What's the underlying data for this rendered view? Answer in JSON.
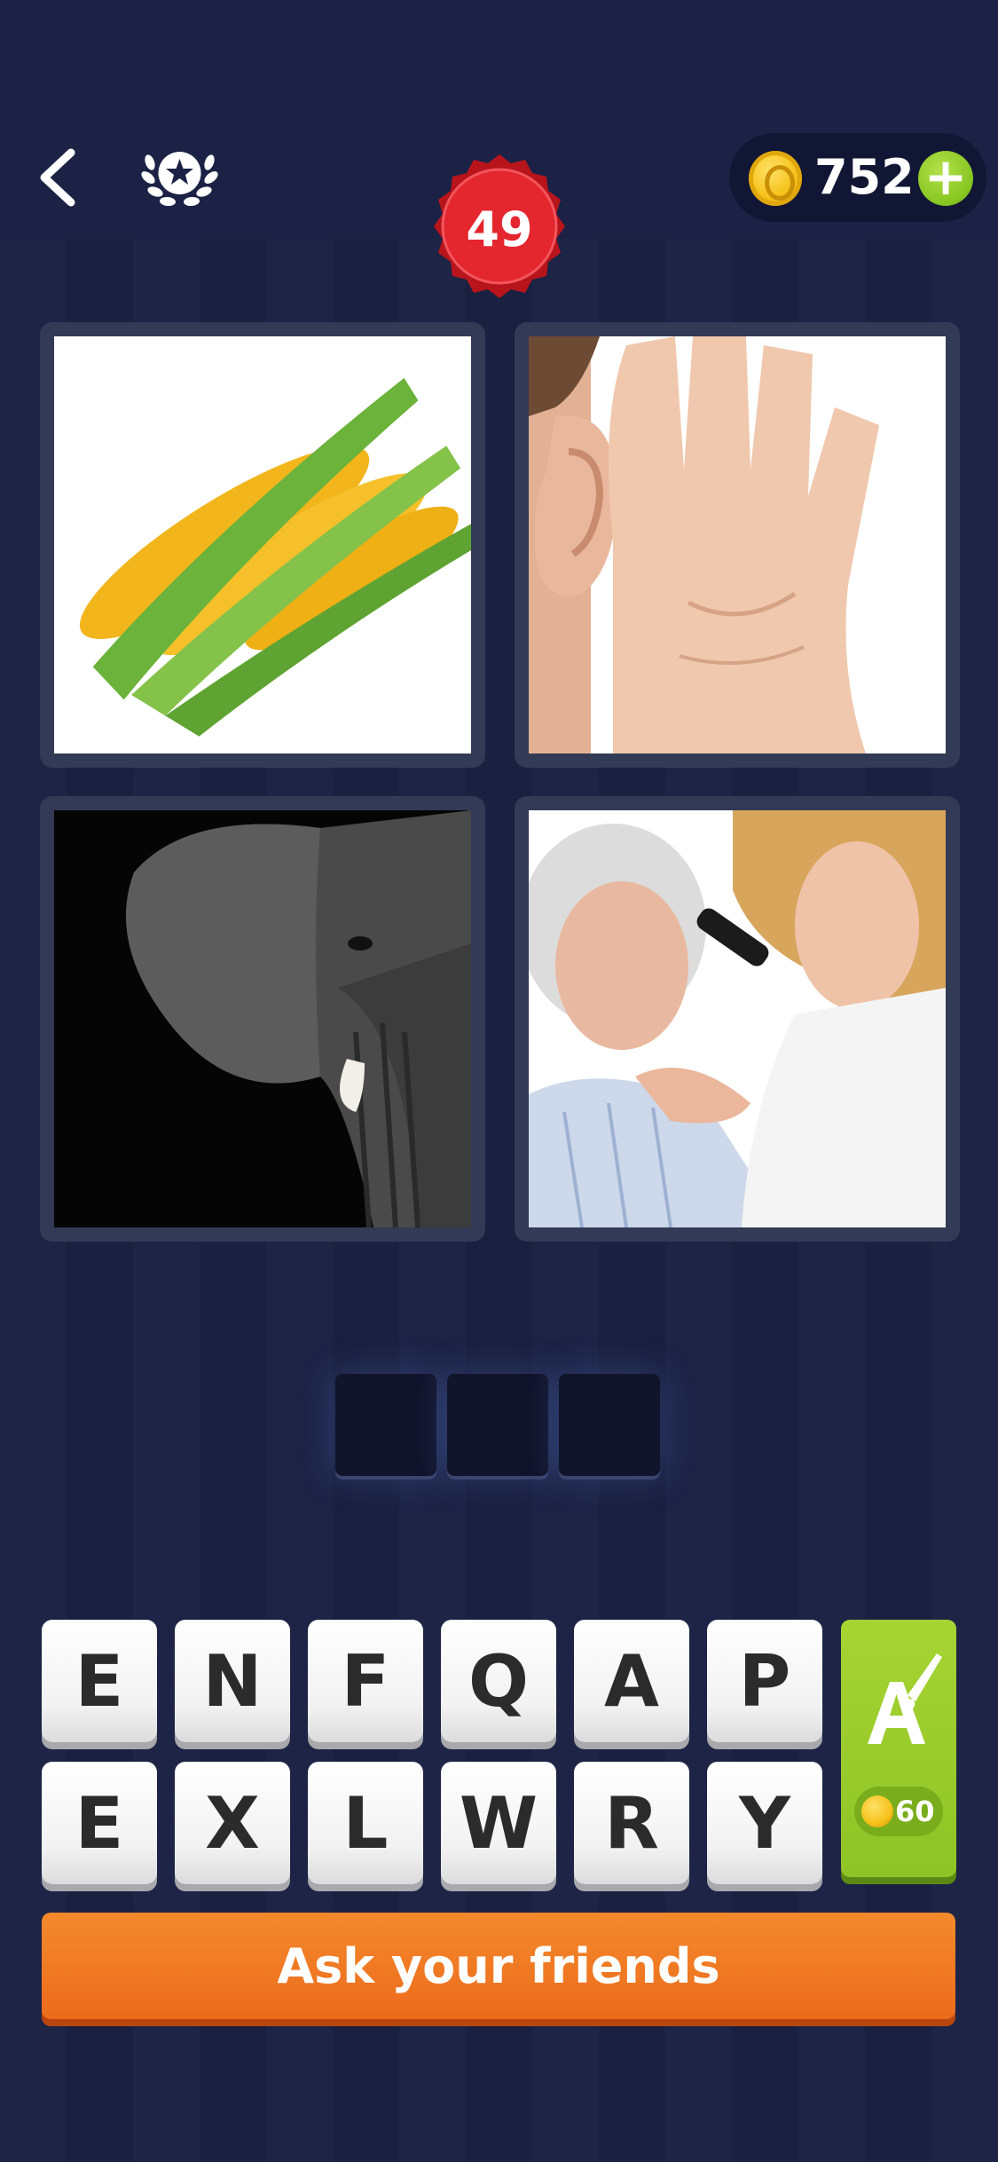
{
  "header": {
    "level": "49",
    "coins": "752",
    "add_coins_label": "+"
  },
  "pictures": [
    {
      "name": "corn-picture",
      "depicts": "corn"
    },
    {
      "name": "ear-picture",
      "depicts": "ear"
    },
    {
      "name": "elephant-picture",
      "depicts": "elephant"
    },
    {
      "name": "ear-exam-picture",
      "depicts": "ear exam"
    }
  ],
  "answer": {
    "length": 3,
    "slots": [
      "",
      "",
      ""
    ]
  },
  "keys": {
    "row1": [
      "E",
      "N",
      "F",
      "Q",
      "A",
      "P"
    ],
    "row2": [
      "E",
      "X",
      "L",
      "W",
      "R",
      "Y"
    ]
  },
  "hint": {
    "icon": "paintbrush-letter-icon",
    "cost": "60"
  },
  "ask_friends": {
    "label": "Ask your friends"
  },
  "colors": {
    "background": "#1b2142",
    "level_badge": "#e0262e",
    "hint_green": "#9acb2d",
    "ask_orange": "#ee7322"
  }
}
